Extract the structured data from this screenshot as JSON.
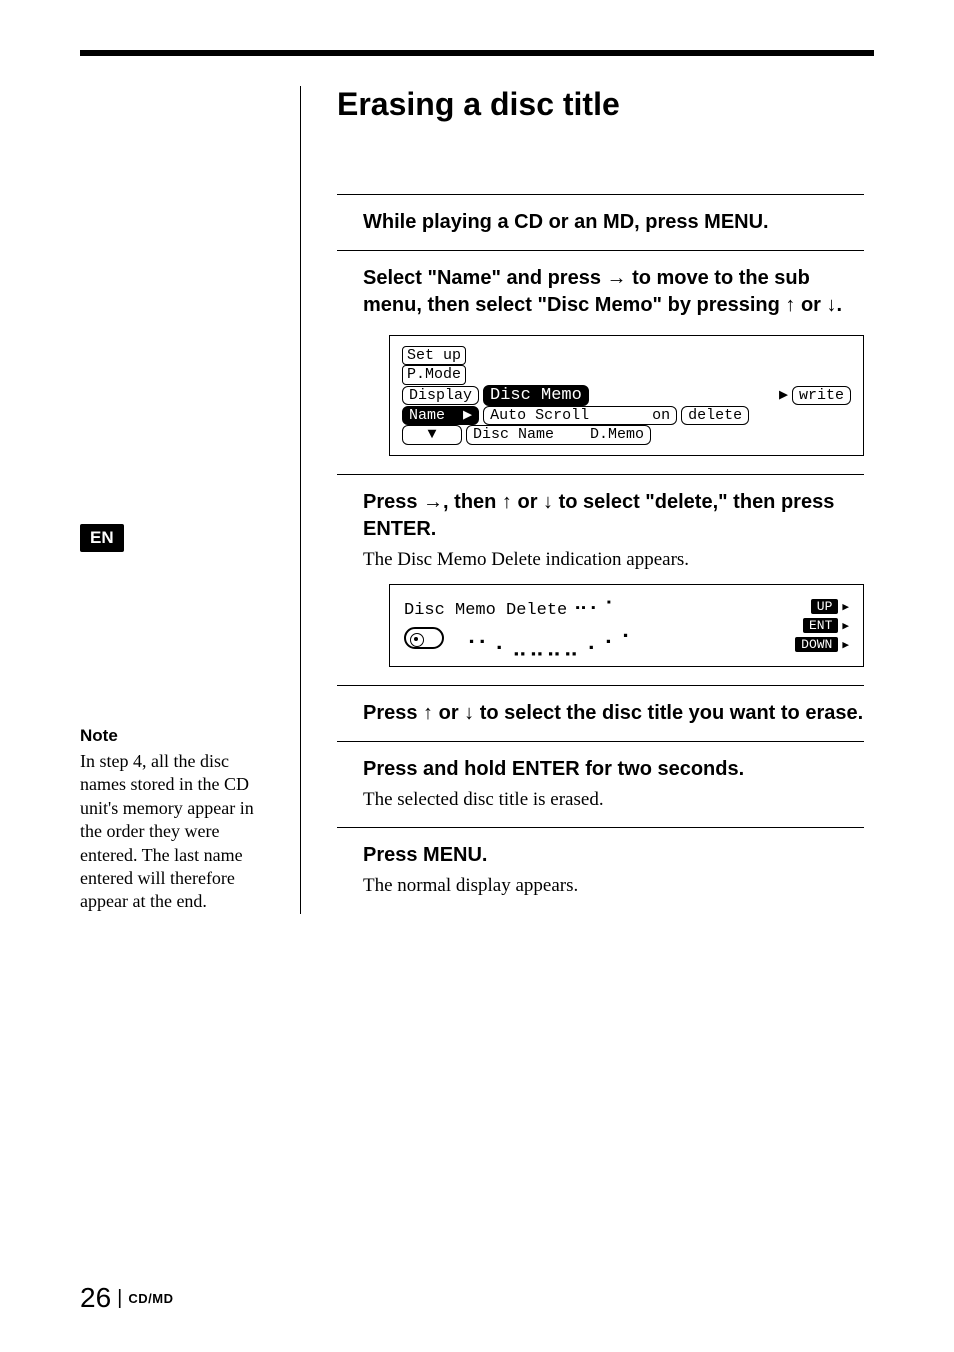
{
  "lang_tab": "EN",
  "title": "Erasing a disc title",
  "steps": {
    "s1": {
      "b": "While playing a CD or an MD, press MENU."
    },
    "s2": {
      "b": "Select \"Name\" and press → to move to the sub menu, then select \"Disc Memo\" by pressing ↑ or ↓."
    },
    "s3": {
      "b": "Press →, then ↑ or ↓ to select \"delete,\" then press ENTER.",
      "p": "The Disc Memo Delete indication appears."
    },
    "s4": {
      "b": "Press ↑ or ↓ to select the disc title you want to erase."
    },
    "s5": {
      "b": "Press and hold ENTER for two seconds.",
      "p": "The selected disc title is erased."
    },
    "s6": {
      "b": "Press MENU.",
      "p": "The normal display appears."
    }
  },
  "lcd_menu": {
    "items_left_top1": "Set up",
    "items_left_top2": "P.Mode",
    "items_left_sel": "Display",
    "items_left_name": "Name",
    "arrow_down": "▼",
    "mid_sel": "Disc Memo",
    "mid_auto": "Auto Scroll",
    "mid_auto_val": "on",
    "mid_disc": "Disc Name",
    "mid_disc_val": "D.Memo",
    "right_write": "write",
    "right_delete": "delete"
  },
  "lcd_delete": {
    "text": "Disc Memo Delete",
    "btn_up": "UP",
    "btn_ent": "ENT",
    "btn_down": "DOWN"
  },
  "note": {
    "h": "Note",
    "p": "In step 4, all the disc names stored in the CD unit's memory appear in the order they were entered. The last name entered will therefore appear at the end."
  },
  "footer": {
    "page": "26",
    "section": "CD/MD"
  }
}
